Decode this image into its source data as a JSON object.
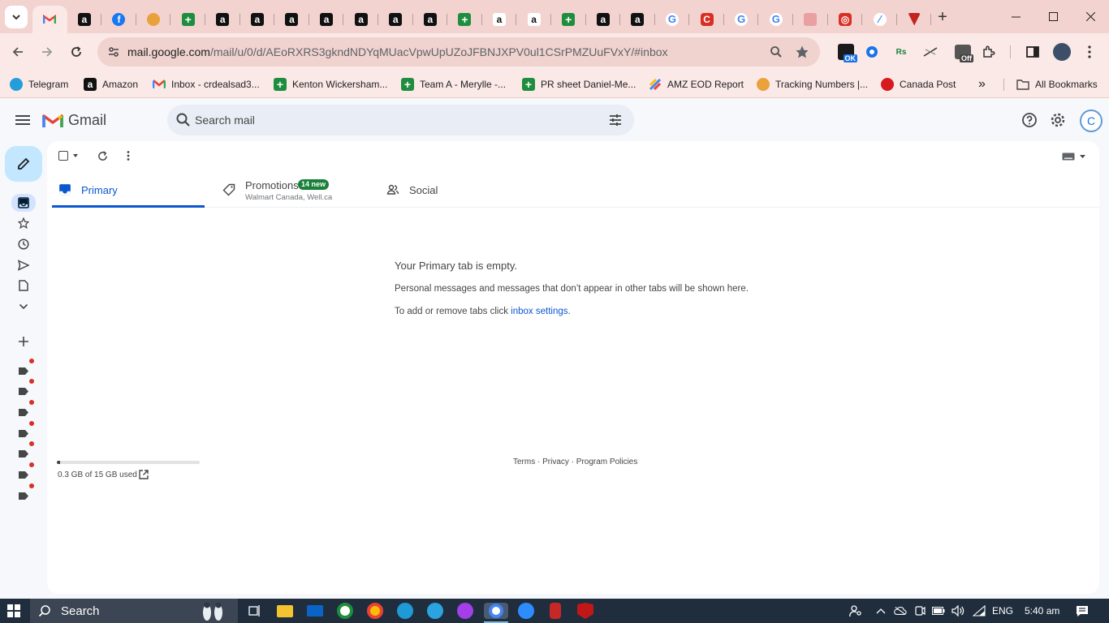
{
  "browser": {
    "tabs": [
      {
        "icon": "gmail",
        "active": true
      },
      {
        "icon": "amazon"
      },
      {
        "icon": "facebook"
      },
      {
        "icon": "taco"
      },
      {
        "icon": "sheets"
      },
      {
        "icon": "amazon"
      },
      {
        "icon": "amazon"
      },
      {
        "icon": "amazon"
      },
      {
        "icon": "amazon"
      },
      {
        "icon": "amazon"
      },
      {
        "icon": "amazon"
      },
      {
        "icon": "amazon"
      },
      {
        "icon": "sheets"
      },
      {
        "icon": "amazon-white"
      },
      {
        "icon": "amazon-white"
      },
      {
        "icon": "sheets"
      },
      {
        "icon": "amazon"
      },
      {
        "icon": "amazon"
      },
      {
        "icon": "google"
      },
      {
        "icon": "red-c"
      },
      {
        "icon": "google"
      },
      {
        "icon": "google"
      },
      {
        "icon": "shield"
      },
      {
        "icon": "target"
      },
      {
        "icon": "taskade"
      },
      {
        "icon": "nav"
      }
    ],
    "new_tab_label": "+",
    "url_host": "mail.google.com",
    "url_path": "/mail/u/0/d/AEoRXRS3gkndNDYqMUacVpwUpUZoJFBNJXPV0ul1CSrPMZUuFVxY/#inbox",
    "ext_ok": "OK",
    "ext_rs": "Rs",
    "ext_off": "Off",
    "bookmarks": [
      {
        "label": "Telegram",
        "icon": "telegram"
      },
      {
        "label": "Amazon",
        "icon": "amazon"
      },
      {
        "label": "Inbox - crdealsad3...",
        "icon": "gmail"
      },
      {
        "label": "Kenton Wickersham...",
        "icon": "sheets"
      },
      {
        "label": "Team A - Merylle -...",
        "icon": "sheets"
      },
      {
        "label": "PR sheet Daniel-Me...",
        "icon": "sheets"
      },
      {
        "label": "AMZ EOD Report",
        "icon": "taskade"
      },
      {
        "label": "Tracking Numbers |...",
        "icon": "taco"
      },
      {
        "label": "Canada Post",
        "icon": "canadapost"
      }
    ],
    "more_bookmarks": "»",
    "all_bookmarks": "All Bookmarks"
  },
  "gmail": {
    "logo_text": "Gmail",
    "search_placeholder": "Search mail",
    "avatar_letter": "C",
    "tabs": {
      "primary": "Primary",
      "promotions": "Promotions",
      "promotions_badge": "14 new",
      "promotions_sub": "Walmart Canada, Well.ca",
      "social": "Social"
    },
    "empty": {
      "title": "Your Primary tab is empty.",
      "description": "Personal messages and messages that don’t appear in other tabs will be shown here.",
      "settings_prefix": "To add or remove tabs click ",
      "settings_link": "inbox settings",
      "settings_suffix": "."
    },
    "storage": {
      "text": "0.3 GB of 15 GB used",
      "used_fraction": 0.02
    },
    "footer": "Terms · Privacy · Program Policies"
  },
  "taskbar": {
    "search_text": "Search",
    "language": "ENG",
    "time": "5:40 am"
  },
  "colors": {
    "accent": "#0b57d0",
    "compose_bg": "#c2e7ff",
    "badge_green": "#188038",
    "label_dot": "#d93025"
  }
}
